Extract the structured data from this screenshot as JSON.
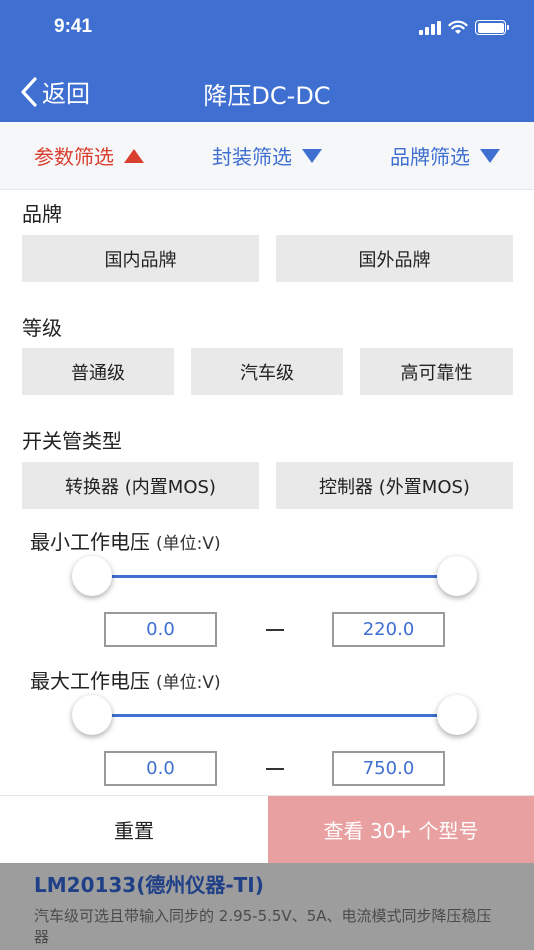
{
  "status_bar": {
    "time": "9:41"
  },
  "nav": {
    "back_label": "返回",
    "title": "降压DC-DC"
  },
  "filter_tabs": [
    {
      "label": "参数筛选",
      "active": true
    },
    {
      "label": "封装筛选",
      "active": false
    },
    {
      "label": "品牌筛选",
      "active": false
    }
  ],
  "brand": {
    "title": "品牌",
    "options": [
      "国内品牌",
      "国外品牌"
    ]
  },
  "grade": {
    "title": "等级",
    "options": [
      "普通级",
      "汽车级",
      "高可靠性"
    ]
  },
  "switch_type": {
    "title": "开关管类型",
    "options": [
      "转换器 (内置MOS)",
      "控制器 (外置MOS)"
    ]
  },
  "min_voltage": {
    "title": "最小工作电压",
    "unit": "(单位:V)",
    "min": "0.0",
    "max": "220.0"
  },
  "max_voltage": {
    "title": "最大工作电压",
    "unit": "(单位:V)",
    "min": "0.0",
    "max": "750.0"
  },
  "bottom": {
    "reset_label": "重置",
    "view_label": "查看 30+ 个型号"
  },
  "result": {
    "title": "LM20133(德州仪器-TI)",
    "description": "汽车级可选且带输入同步的 2.95-5.5V、5A、电流模式同步降压稳压器"
  },
  "colors": {
    "accent": "#3f6fd0",
    "active": "#d93f2e",
    "view_button": "#e8a0a0"
  }
}
